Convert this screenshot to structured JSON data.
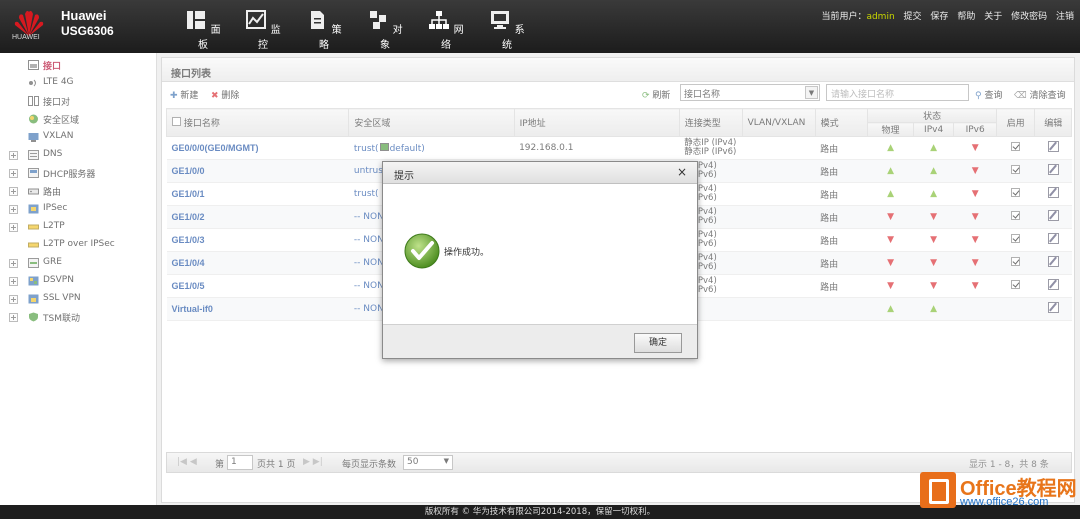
{
  "brand": {
    "name": "Huawei",
    "model": "USG6306",
    "logo_text": "HUAWEI"
  },
  "nav": [
    {
      "label": "面板",
      "icon": "dashboard-icon"
    },
    {
      "label": "监控",
      "icon": "monitor-icon"
    },
    {
      "label": "策略",
      "icon": "policy-icon"
    },
    {
      "label": "对象",
      "icon": "object-icon"
    },
    {
      "label": "网络",
      "icon": "network-icon",
      "active": true
    },
    {
      "label": "系统",
      "icon": "system-icon"
    }
  ],
  "topright": {
    "user_label": "当前用户：",
    "user": "admin",
    "links": [
      "提交",
      "保存",
      "帮助",
      "关于",
      "修改密码",
      "注销"
    ]
  },
  "sidebar": {
    "items": [
      {
        "label": "接口",
        "selected": true,
        "expandable": false
      },
      {
        "label": "LTE 4G",
        "expandable": false
      },
      {
        "label": "接口对",
        "expandable": false
      },
      {
        "label": "安全区域",
        "expandable": false
      },
      {
        "label": "VXLAN",
        "expandable": false
      },
      {
        "label": "DNS",
        "expandable": true
      },
      {
        "label": "DHCP服务器",
        "expandable": true
      },
      {
        "label": "路由",
        "expandable": true
      },
      {
        "label": "IPSec",
        "expandable": true
      },
      {
        "label": "L2TP",
        "expandable": true
      },
      {
        "label": "L2TP over IPSec",
        "expandable": false
      },
      {
        "label": "GRE",
        "expandable": true
      },
      {
        "label": "DSVPN",
        "expandable": true
      },
      {
        "label": "SSL VPN",
        "expandable": true
      },
      {
        "label": "TSM联动",
        "expandable": true
      }
    ]
  },
  "content": {
    "title": "接口列表",
    "toolbar": {
      "new_label": "新建",
      "delete_label": "删除",
      "refresh_label": "刷新",
      "query_label": "查询",
      "clear_label": "清除查询"
    },
    "filter_select": "接口名称",
    "search_placeholder": "请输入接口名称"
  },
  "table": {
    "headers": {
      "name": "接口名称",
      "zone": "安全区域",
      "ip": "IP地址",
      "conn": "连接类型",
      "vlan": "VLAN/VXLAN",
      "mode": "模式",
      "status": "状态",
      "physical": "物理",
      "ipv4": "IPv4",
      "ipv6": "IPv6",
      "enable": "启用",
      "edit": "编辑"
    },
    "rows": [
      {
        "name": "GE0/0/0(GE0/MGMT)",
        "zone": "trust(",
        "zone2": "default)",
        "ip": "192.168.0.1",
        "conn1": "静态IP (IPv4)",
        "conn2": "静态IP (IPv6)",
        "mode": "路由",
        "physical": "up",
        "ipv4": "up",
        "ipv6": "down",
        "enabled": true
      },
      {
        "name": "GE1/0/0",
        "zone": "untrust",
        "zone2": "",
        "ip": "",
        "conn1": "P (IPv4)",
        "conn2": "P (IPv6)",
        "mode": "路由",
        "physical": "up",
        "ipv4": "up",
        "ipv6": "down",
        "enabled": true
      },
      {
        "name": "GE1/0/1",
        "zone": "trust(",
        "zone2": "",
        "ip": "",
        "conn1": "P (IPv4)",
        "conn2": "P (IPv6)",
        "mode": "路由",
        "physical": "up",
        "ipv4": "up",
        "ipv6": "down",
        "enabled": true
      },
      {
        "name": "GE1/0/2",
        "zone": "-- NON",
        "zone2": "",
        "ip": "",
        "conn1": "P (IPv4)",
        "conn2": "P (IPv6)",
        "mode": "路由",
        "physical": "down",
        "ipv4": "down",
        "ipv6": "down",
        "enabled": true
      },
      {
        "name": "GE1/0/3",
        "zone": "-- NON",
        "zone2": "",
        "ip": "",
        "conn1": "P (IPv4)",
        "conn2": "P (IPv6)",
        "mode": "路由",
        "physical": "down",
        "ipv4": "down",
        "ipv6": "down",
        "enabled": true
      },
      {
        "name": "GE1/0/4",
        "zone": "-- NON",
        "zone2": "",
        "ip": "",
        "conn1": "P (IPv4)",
        "conn2": "P (IPv6)",
        "mode": "路由",
        "physical": "down",
        "ipv4": "down",
        "ipv6": "down",
        "enabled": true
      },
      {
        "name": "GE1/0/5",
        "zone": "-- NON",
        "zone2": "",
        "ip": "",
        "conn1": "P (IPv4)",
        "conn2": "P (IPv6)",
        "mode": "路由",
        "physical": "down",
        "ipv4": "down",
        "ipv6": "down",
        "enabled": true
      },
      {
        "name": "Virtual-if0",
        "zone": "-- NON",
        "zone2": "",
        "ip": "",
        "conn1": "",
        "conn2": "",
        "mode": "",
        "physical": "up",
        "ipv4": "up",
        "ipv6": "",
        "enabled": false
      }
    ]
  },
  "pager": {
    "page_label": "第",
    "page_value": "1",
    "of_label": "页共 1 页",
    "per_page_label": "每页显示条数",
    "per_page_value": "50",
    "summary": "显示 1 - 8，共 8 条"
  },
  "dialog": {
    "title": "提示",
    "message": "操作成功。",
    "ok_label": "确定"
  },
  "footer": {
    "copyright": "版权所有 © 华为技术有限公司2014-2018，保留一切权利。"
  },
  "watermark": {
    "title": "Office教程网",
    "url": "www.office26.com"
  },
  "colors": {
    "up": "#7cbb2e",
    "down": "#d8242a",
    "link": "#1a4ea1",
    "selected": "#b0002a",
    "brand": "#c8102e"
  }
}
